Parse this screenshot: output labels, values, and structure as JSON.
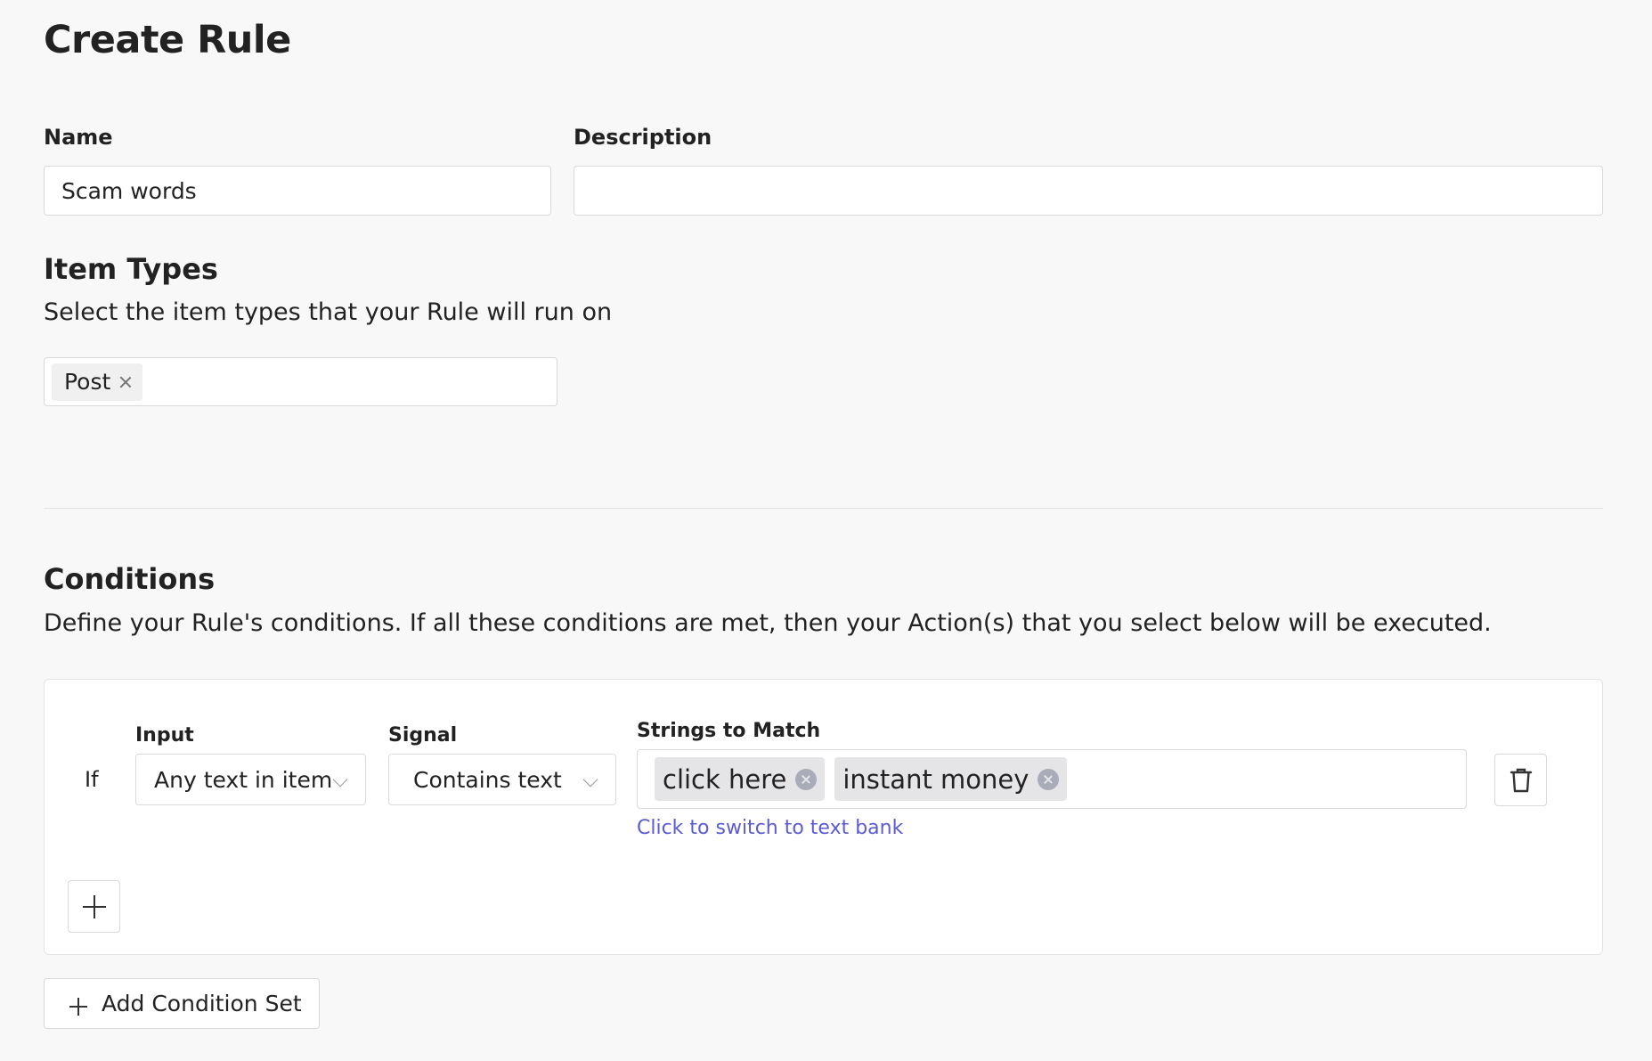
{
  "page": {
    "title": "Create Rule"
  },
  "form": {
    "name_label": "Name",
    "name_value": "Scam words",
    "description_label": "Description",
    "description_value": ""
  },
  "item_types": {
    "title": "Item Types",
    "description": "Select the item types that your Rule will run on",
    "selected": [
      {
        "label": "Post"
      }
    ]
  },
  "conditions": {
    "title": "Conditions",
    "description": "Define your Rule's conditions. If all these conditions are met, then your Action(s) that you select below will be executed.",
    "rows": [
      {
        "if_label": "If",
        "input_label": "Input",
        "input_value": "Any text in item",
        "signal_label": "Signal",
        "signal_value": "Contains text",
        "strings_label": "Strings to Match",
        "strings": [
          "click here",
          "instant money"
        ],
        "switch_link": "Click to switch to text bank"
      }
    ],
    "add_condition_set_label": "Add Condition Set"
  },
  "icons": {
    "delete": "trash-icon",
    "add": "plus-icon",
    "dropdown": "chevron-down-icon",
    "remove": "close-icon"
  },
  "colors": {
    "background": "#f8f8f8",
    "link": "#5b5bd6",
    "chip_background": "#e5e5e8"
  }
}
